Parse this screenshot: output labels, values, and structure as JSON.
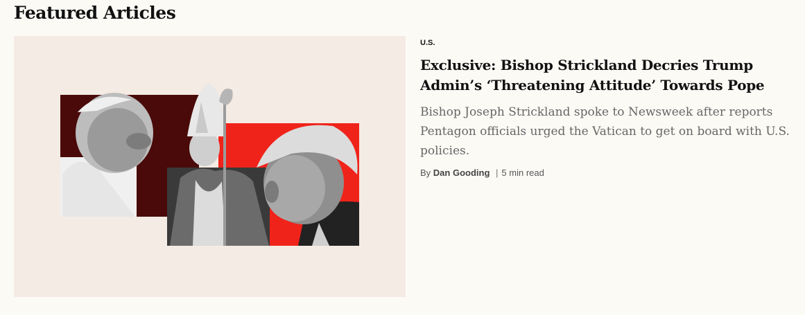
{
  "section": {
    "title": "Featured Articles"
  },
  "article": {
    "category": "U.S.",
    "headline": "Exclusive: Bishop Strickland Decries Trump Admin’s ‘Threatening Attitude’ Towards Pope",
    "summary": "Bishop Joseph Strickland spoke to Newsweek after reports Pentagon officials urged the Vatican to get on board with U.S. policies.",
    "byline_prefix": "By",
    "author": "Dan Gooding",
    "separator": "|",
    "read_time": "5 min read"
  },
  "colors": {
    "page_background": "#fcfaf5",
    "image_background": "#f4ebe4",
    "dark_red": "#4a0a0a",
    "bright_red": "#f0231a"
  }
}
